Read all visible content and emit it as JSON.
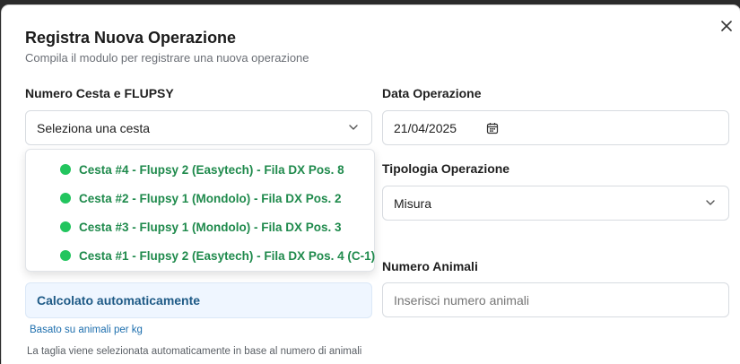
{
  "dialog": {
    "title": "Registra Nuova Operazione",
    "subtitle": "Compila il modulo per registrare una nuova operazione"
  },
  "basket": {
    "label": "Numero Cesta e FLUPSY",
    "value": "Seleziona una cesta",
    "options": [
      "Cesta #4 - Flupsy 2 (Easytech) - Fila DX Pos. 8",
      "Cesta #2 - Flupsy 1 (Mondolo) - Fila DX Pos. 2",
      "Cesta #3 - Flupsy 1 (Mondolo) - Fila DX Pos. 3",
      "Cesta #1 - Flupsy 2 (Easytech) - Fila DX Pos. 4 (C-1)"
    ]
  },
  "date": {
    "label": "Data Operazione",
    "value": "21/04/2025"
  },
  "type": {
    "label": "Tipologia Operazione",
    "value": "Misura"
  },
  "animals": {
    "label": "Numero Animali",
    "placeholder": "Inserisci numero animali"
  },
  "size": {
    "auto_text": "Calcolato automaticamente",
    "basis": "Basato su animali per kg",
    "note": "La taglia viene selezionata automaticamente in base al numero di animali"
  },
  "colors": {
    "option_text": "#1f8a4c",
    "status_dot": "#22c55e",
    "info_bg": "#eff6ff",
    "info_text": "#1e5a86"
  }
}
